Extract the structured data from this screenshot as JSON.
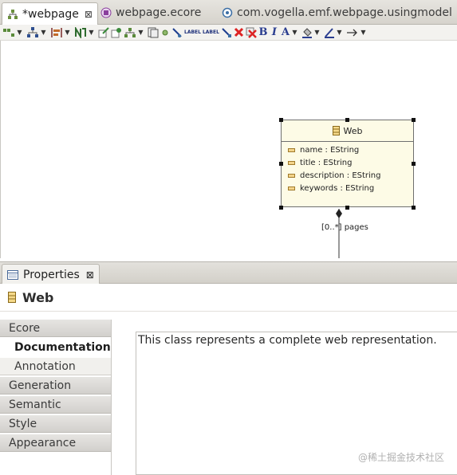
{
  "editor_tabs": [
    {
      "label": "*webpage",
      "icon": "diagram-icon",
      "active": true,
      "close": "⊠"
    },
    {
      "label": "webpage.ecore",
      "icon": "ecore-icon",
      "active": false
    },
    {
      "label": "com.vogella.emf.webpage.usingmodel",
      "icon": "plugin-icon",
      "active": false
    }
  ],
  "toolbar": {
    "bold": "B",
    "italic": "I",
    "font_color": "A",
    "label_a": "LABEL",
    "label_b": "LABEL"
  },
  "diagram": {
    "class_name": "Web",
    "attributes": [
      "name : EString",
      "title : EString",
      "description : EString",
      "keywords : EString"
    ],
    "edge_label": "[0..*] pages"
  },
  "properties": {
    "tab_label": "Properties",
    "tab_close": "⊠",
    "title": "Web",
    "categories": [
      "Ecore",
      "Documentation",
      "Annotation",
      "Generation",
      "Semantic",
      "Style",
      "Appearance"
    ],
    "active_category": "Documentation",
    "documentation_text": "This class represents a complete web representation."
  },
  "watermark": "@稀土掘金技术社区",
  "colors": {
    "node_fill": "#fdfbe6",
    "canvas": "#ffffff",
    "tab_bar": "#d6d3cc"
  }
}
